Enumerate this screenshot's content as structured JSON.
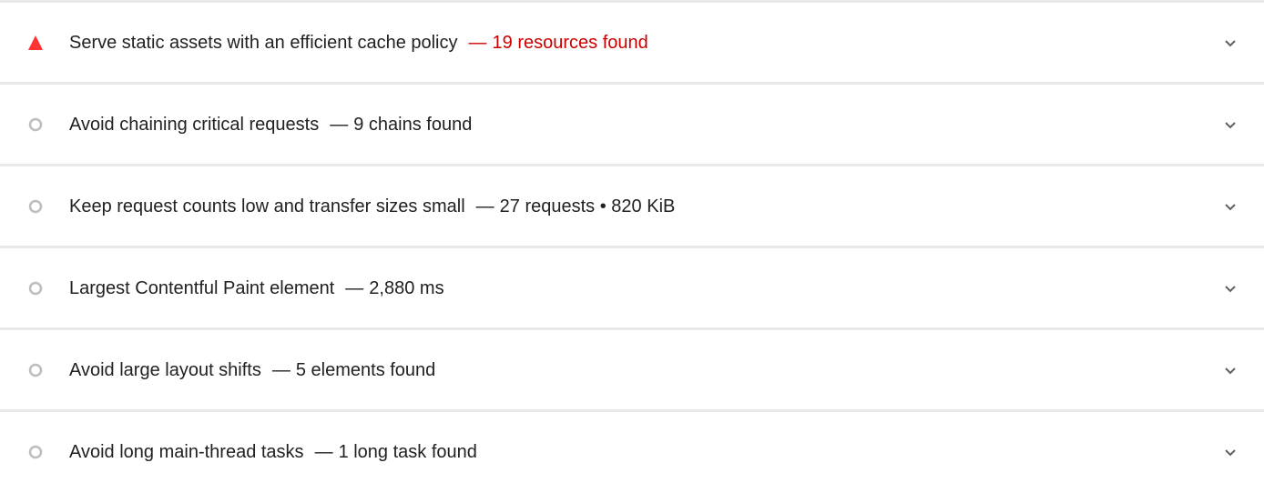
{
  "audits": [
    {
      "status": "fail",
      "status_icon": "red-triangle-icon",
      "title": "Serve static assets with an efficient cache policy",
      "separator": "—",
      "display_value": "19 resources found"
    },
    {
      "status": "informative",
      "status_icon": "gray-circle-icon",
      "title": "Avoid chaining critical requests",
      "separator": "—",
      "display_value": "9 chains found"
    },
    {
      "status": "informative",
      "status_icon": "gray-circle-icon",
      "title": "Keep request counts low and transfer sizes small",
      "separator": "—",
      "display_value": "27 requests • 820 KiB"
    },
    {
      "status": "informative",
      "status_icon": "gray-circle-icon",
      "title": "Largest Contentful Paint element",
      "separator": "—",
      "display_value": "2,880 ms"
    },
    {
      "status": "informative",
      "status_icon": "gray-circle-icon",
      "title": "Avoid large layout shifts",
      "separator": "—",
      "display_value": "5 elements found"
    },
    {
      "status": "informative",
      "status_icon": "gray-circle-icon",
      "title": "Avoid long main-thread tasks",
      "separator": "—",
      "display_value": "1 long task found"
    }
  ],
  "colors": {
    "fail": "#cc0000",
    "fail_icon": "#ff3333",
    "informative_icon": "#bdbdbd",
    "text": "#212121",
    "chevron": "#606060",
    "divider": "#e8e8e8"
  }
}
